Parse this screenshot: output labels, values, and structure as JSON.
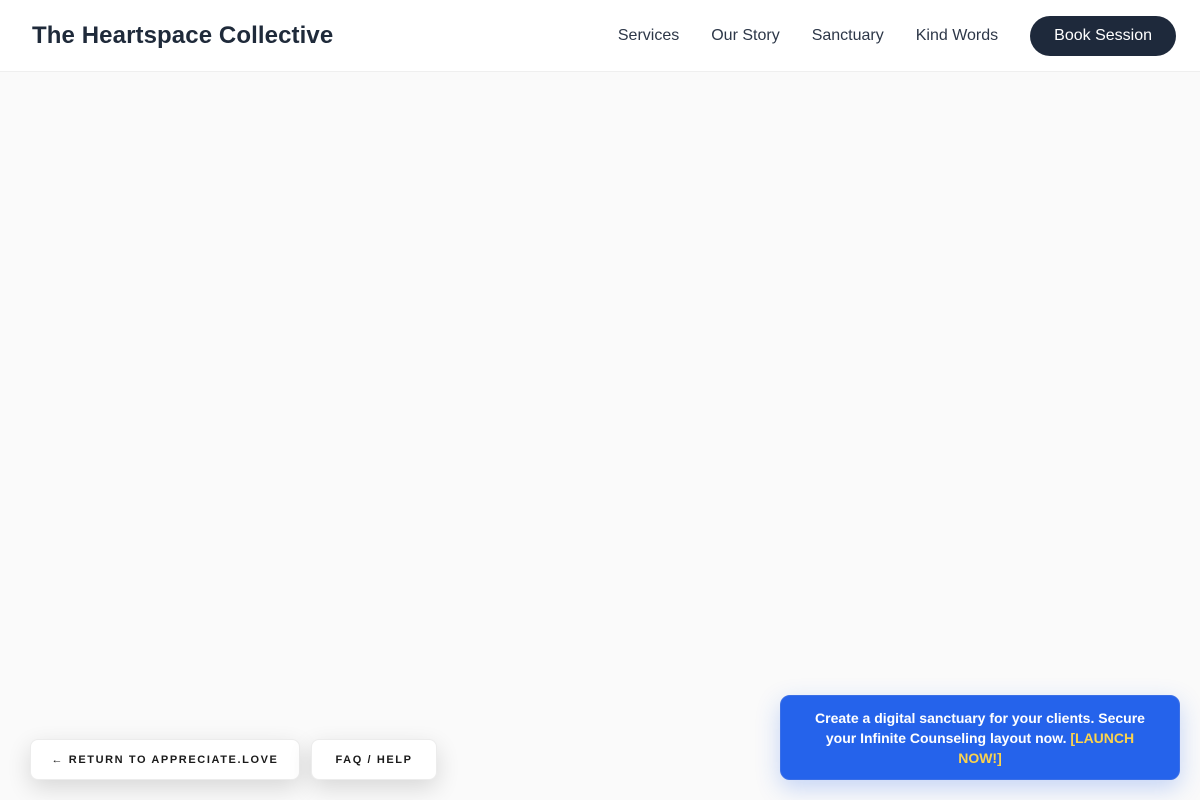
{
  "header": {
    "brand": "The Heartspace Collective",
    "nav": [
      "Services",
      "Our Story",
      "Sanctuary",
      "Kind Words"
    ],
    "cta_label": "Book Session"
  },
  "bottom_bar": {
    "return_label": "← RETURN TO APPRECIATE.LOVE",
    "faq_label": "FAQ / HELP"
  },
  "promo": {
    "text": "Create a digital sanctuary for your clients. Secure your Infinite Counseling layout now.",
    "link_label": "[LAUNCH NOW!]"
  },
  "colors": {
    "background": "#fafafa",
    "header_bg": "#ffffff",
    "cta_bg": "#1e293b",
    "promo_bg": "#2563eb",
    "promo_link": "#fcd34d"
  }
}
